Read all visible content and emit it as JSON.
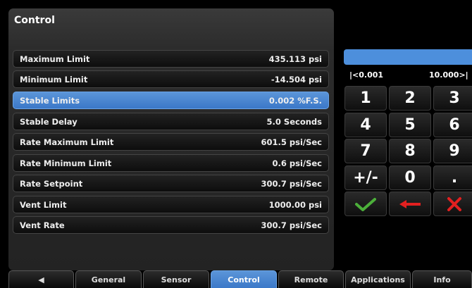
{
  "panel": {
    "title": "Control"
  },
  "rows": [
    {
      "label": "Maximum Limit",
      "value": "435.113 psi"
    },
    {
      "label": "Minimum Limit",
      "value": "-14.504 psi"
    },
    {
      "label": "Stable Limits",
      "value": "0.002 %F.S.",
      "selected": true
    },
    {
      "label": "Stable Delay",
      "value": "5.0 Seconds"
    },
    {
      "label": "Rate Maximum Limit",
      "value": "601.5 psi/Sec"
    },
    {
      "label": "Rate Minimum Limit",
      "value": "0.6 psi/Sec"
    },
    {
      "label": "Rate Setpoint",
      "value": "300.7 psi/Sec"
    },
    {
      "label": "Vent Limit",
      "value": "1000.00 psi"
    },
    {
      "label": "Vent Rate",
      "value": "300.7 psi/Sec"
    }
  ],
  "keypad": {
    "entry_value": "",
    "range_min": "|<0.001",
    "range_max": "10.000>|",
    "keys": [
      "1",
      "2",
      "3",
      "4",
      "5",
      "6",
      "7",
      "8",
      "9",
      "+/-",
      "0",
      "."
    ],
    "accept_icon": "check-icon",
    "backspace_icon": "left-arrow-icon",
    "cancel_icon": "x-icon"
  },
  "tabs": [
    {
      "label": "◀",
      "icon": "back-arrow-icon"
    },
    {
      "label": "General"
    },
    {
      "label": "Sensor"
    },
    {
      "label": "Control",
      "active": true
    },
    {
      "label": "Remote"
    },
    {
      "label": "Applications"
    },
    {
      "label": "Info"
    }
  ],
  "colors": {
    "selection": "#4d8fdc",
    "accept": "#4caf3a",
    "cancel": "#e32020"
  }
}
